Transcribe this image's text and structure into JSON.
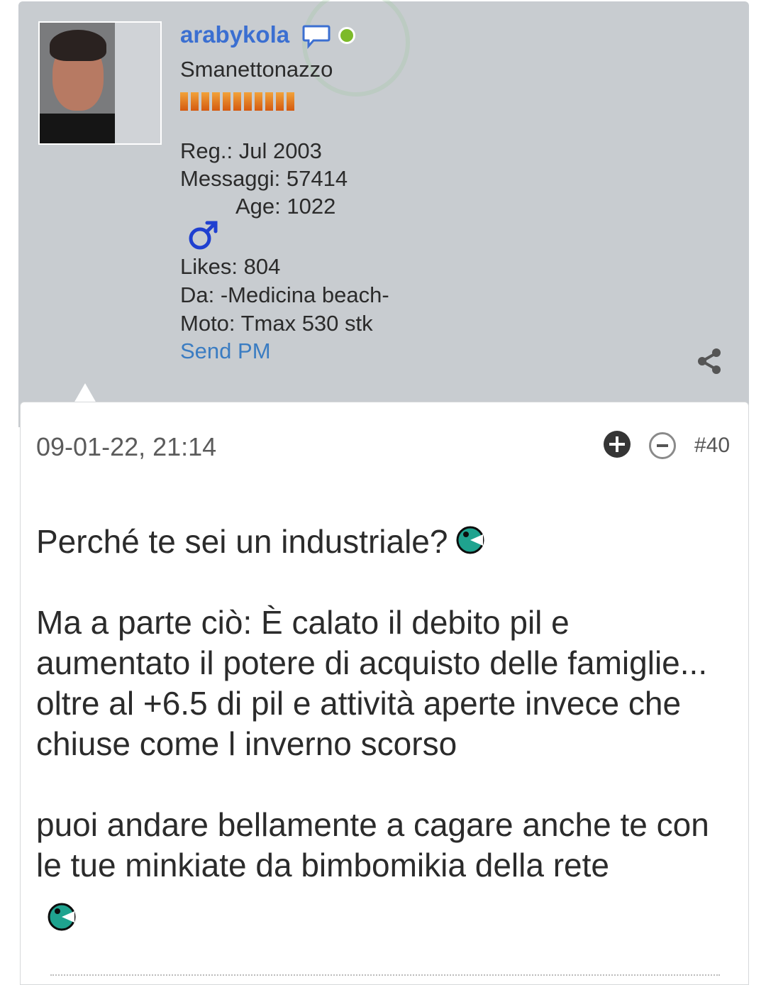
{
  "user": {
    "username": "arabykola",
    "title": "Smanettonazzo",
    "online_status_color": "#7dba2a",
    "rank_bars": 11,
    "reg": "Reg.: Jul 2003",
    "messages": "Messaggi: 57414",
    "age": "Age: 1022",
    "gender_icon": "male-icon",
    "likes": "Likes: 804",
    "location": "Da: -Medicina beach-",
    "moto": "Moto: Tmax 530 stk",
    "send_pm": "Send PM"
  },
  "post": {
    "date": "09-01-22, 21:14",
    "number": "#40",
    "lines": {
      "p1": "Perché te sei un industriale?",
      "p2": "Ma a parte ciò: È calato il debito pil e aumentato il potere di acquisto delle famiglie... oltre al +6.5 di pil e attività aperte invece che chiuse come l inverno scorso",
      "p3": "puoi andare bellamente a cagare anche te con le tue minkiate da bimbomikia della rete"
    }
  },
  "colors": {
    "username": "#3b6fd1",
    "link": "#3a7cc2",
    "card_bg": "#c8ccd0"
  }
}
